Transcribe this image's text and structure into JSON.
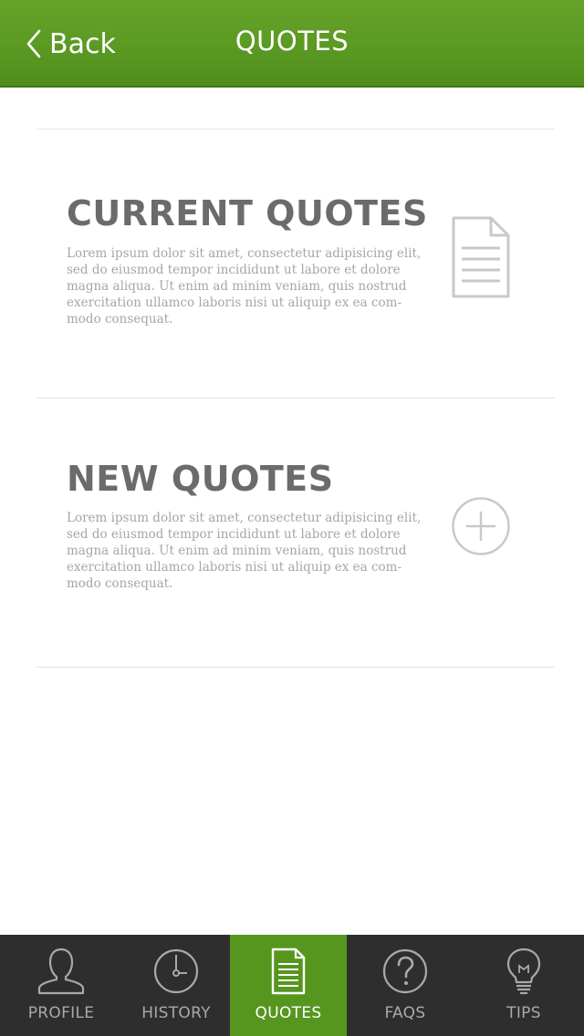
{
  "header": {
    "back_label": "Back",
    "title": "QUOTES"
  },
  "sections": [
    {
      "title": "CURRENT QUOTES",
      "body": "Lorem ipsum dolor sit amet, consectetur adipisicing elit, sed do eiusmod tempor incididunt ut labore et dolore magna aliqua. Ut enim ad minim veniam, quis nostrud exercitation ullamco laboris nisi ut aliquip ex ea com-modo consequat.",
      "icon": "document-icon"
    },
    {
      "title": "NEW QUOTES",
      "body": "Lorem ipsum dolor sit amet, consectetur adipisicing elit, sed do eiusmod tempor incididunt ut labore et dolore magna aliqua. Ut enim ad minim veniam, quis nostrud exercitation ullamco laboris nisi ut aliquip ex ea com-modo consequat.",
      "icon": "plus-circle-icon"
    }
  ],
  "tabbar": {
    "active": "QUOTES",
    "active_color": "#56961f",
    "tabs": [
      {
        "label": "PROFILE",
        "icon": "person-icon"
      },
      {
        "label": "HISTORY",
        "icon": "clock-icon"
      },
      {
        "label": "QUOTES",
        "icon": "document-icon"
      },
      {
        "label": "FAQS",
        "icon": "question-icon"
      },
      {
        "label": "TIPS",
        "icon": "lightbulb-icon"
      }
    ]
  },
  "colors": {
    "header_green": "#5a9a23",
    "tabbar_bg": "#2e2e2e",
    "title_gray": "#6b6b6b",
    "body_gray": "#a6a6a6"
  }
}
